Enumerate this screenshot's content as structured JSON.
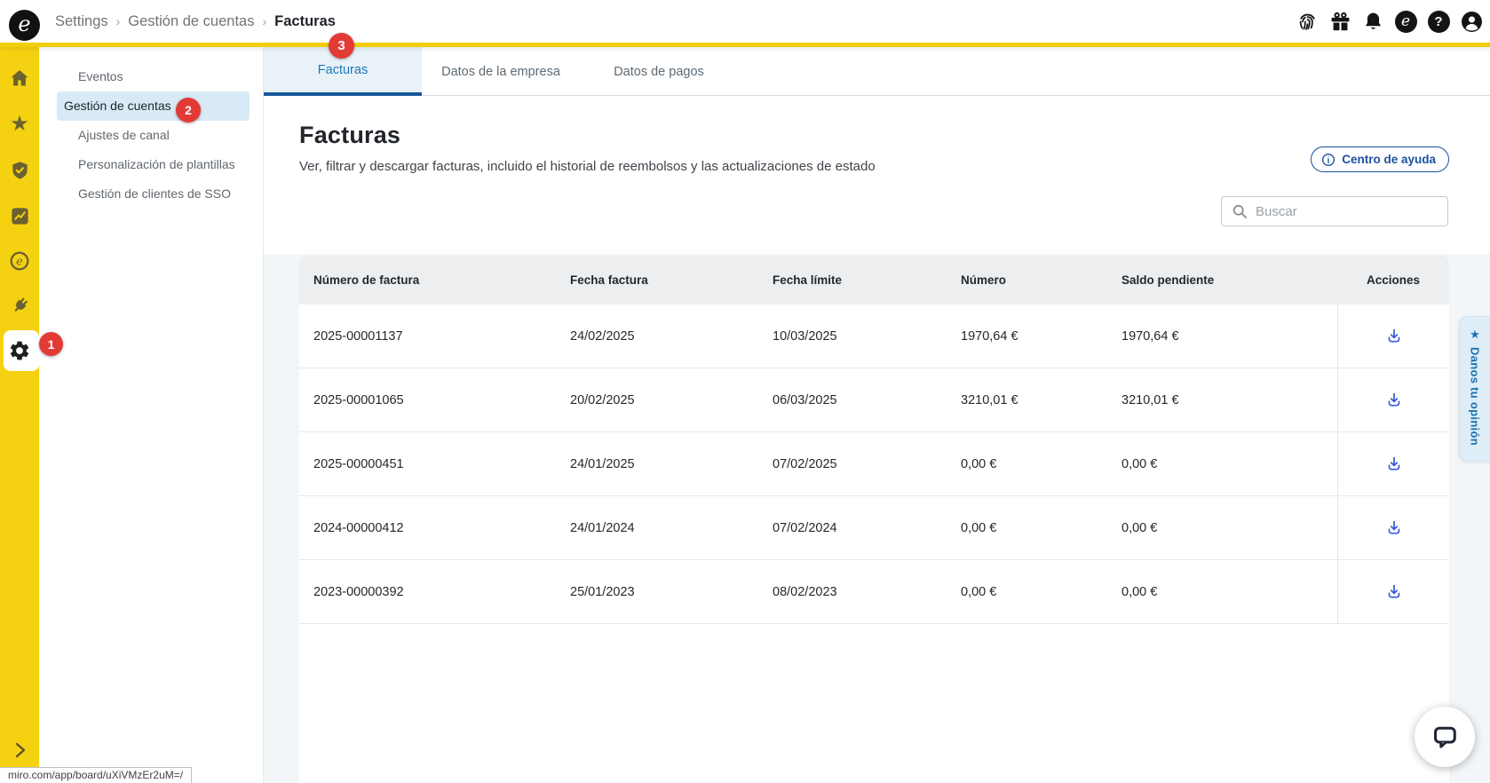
{
  "topbar": {
    "logo_letter": "e",
    "breadcrumb": {
      "items": [
        "Settings",
        "Gestión de cuentas",
        "Facturas"
      ],
      "separator": "›"
    },
    "help_glyph": "?",
    "brand_glyph": "e"
  },
  "rail": {
    "star_glyph": "★"
  },
  "badges": {
    "rail": "1",
    "sidebar": "2",
    "tab": "3"
  },
  "sidebar": {
    "items": [
      "Eventos",
      "Gestión de cuentas",
      "Ajustes de canal",
      "Personalización de plantillas",
      "Gestión de clientes de SSO"
    ]
  },
  "tabs": {
    "items": [
      "Facturas",
      "Datos de la empresa",
      "Datos de pagos"
    ]
  },
  "page": {
    "title": "Facturas",
    "subtitle": "Ver, filtrar y descargar facturas, incluido el historial de reembolsos y las actualizaciones de estado",
    "help_button": "Centro de ayuda",
    "search_placeholder": "Buscar"
  },
  "table": {
    "headers": [
      "Número de factura",
      "Fecha factura",
      "Fecha límite",
      "Número",
      "Saldo pendiente",
      "Acciones"
    ],
    "rows": [
      [
        "2025-00001137",
        "24/02/2025",
        "10/03/2025",
        "1970,64 €",
        "1970,64 €"
      ],
      [
        "2025-00001065",
        "20/02/2025",
        "06/03/2025",
        "3210,01 €",
        "3210,01 €"
      ],
      [
        "2025-00000451",
        "24/01/2025",
        "07/02/2025",
        "0,00 €",
        "0,00 €"
      ],
      [
        "2024-00000412",
        "24/01/2024",
        "07/02/2024",
        "0,00 €",
        "0,00 €"
      ],
      [
        "2023-00000392",
        "25/01/2023",
        "08/02/2023",
        "0,00 €",
        "0,00 €"
      ]
    ]
  },
  "feedback": {
    "star": "★",
    "label": "Danos tu opinión"
  },
  "statusbar": {
    "url": "miro.com/app/board/uXiVMzEr2uM=/"
  },
  "colors": {
    "accent_yellow": "#F5D211",
    "accent_blue": "#1C77B8",
    "badge_red": "#E23B35",
    "link_blue": "#1E4F9F",
    "download_blue": "#3A5AD9"
  }
}
